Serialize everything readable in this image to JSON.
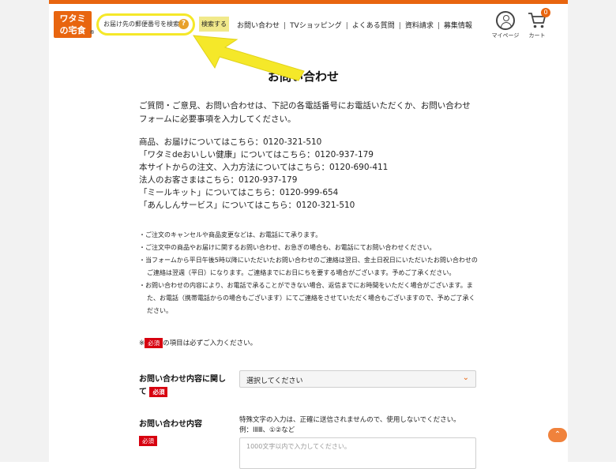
{
  "header": {
    "logo": {
      "line1": "ワタミ",
      "line2": "の宅食",
      "mark": "®"
    },
    "search": {
      "placeholder": "お届け先の郵便番号を検索",
      "help_icon": "?"
    },
    "search_button": "検索する",
    "nav": [
      "お問い合わせ",
      "TVショッピング",
      "よくある質問",
      "資料請求",
      "募集情報"
    ],
    "nav_separator": "|",
    "mypage_label": "マイページ",
    "cart_label": "カート",
    "cart_count": "0"
  },
  "page": {
    "title": "お問い合わせ",
    "intro": "ご質問・ご意見、お問い合わせは、下記の各電話番号にお電話いただくか、お問い合わせフォームに必要事項を入力してください。",
    "phones": [
      "商品、お届けについてはこちら：0120-321-510",
      "「ワタミdeおいしい健康」についてはこちら：0120-937-179",
      "本サイトからの注文、入力方法についてはこちら：0120-690-411",
      "法人のお客さまはこちら：0120-937-179",
      "「ミールキット」についてはこちら：0120-999-654",
      "「あんしんサービス」についてはこちら：0120-321-510"
    ],
    "notes": [
      "・ご注文のキャンセルや商品変更などは、お電話にて承ります。",
      "・ご注文中の商品やお届けに関するお問い合わせ、お急ぎの場合も、お電話にてお問い合わせください。",
      "・当フォームから平日午後5時以降にいただいたお問い合わせのご連絡は翌日、金土日祝日にいただいたお問い合わせのご連絡は翌週（平日）になります。ご連絡までにお日にちを要する場合がございます。予めご了承ください。",
      "・お問い合わせの内容により、お電話で承ることができない場合、返信までにお時間をいただく場合がございます。また、お電話（携帯電話からの場合もございます）にてご連絡をさせていただく場合もございますので、予めご了承ください。"
    ],
    "required_note_prefix": "※",
    "required_badge": "必須",
    "required_note_suffix": "の項目は必ずご入力ください。"
  },
  "form": {
    "inquiry_type": {
      "label": "お問い合わせ内容に関して",
      "required": "必須",
      "selected": "選択してください"
    },
    "inquiry_body": {
      "label": "お問い合わせ内容",
      "required": "必須",
      "help": "特殊文字の入力は、正確に送信されませんので、使用しないでください。",
      "example": "例：ⅠⅡⅢ、①②など",
      "placeholder": "1000文字以内で入力してください。"
    }
  },
  "colors": {
    "accent": "#e8650f",
    "highlight": "#f5e829",
    "required": "#d7000f"
  },
  "back_to_top_icon": "chevron-up-icon"
}
